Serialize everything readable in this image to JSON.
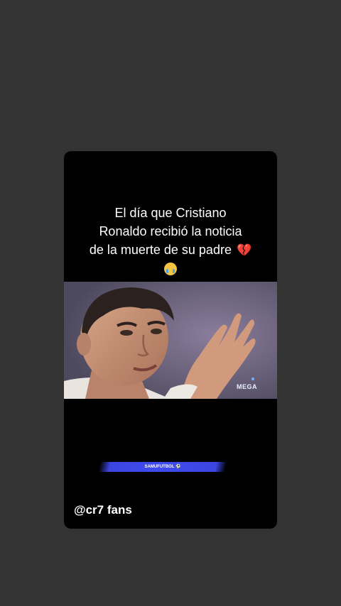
{
  "story": {
    "caption_lines": [
      "El día que Cristiano",
      "Ronaldo recibió la noticia",
      "de la muerte de su padre"
    ],
    "caption_emoji_heart": "💔",
    "handle": "@cr7 fans",
    "banner_text": "SAMUFUTBOL ⚽",
    "watermark": "MEGA"
  },
  "colors": {
    "background": "#333333",
    "card": "#000000",
    "banner": "#3f4bef",
    "heart": "#e0243a"
  },
  "icons": [
    "broken-heart-icon",
    "crying-face-icon",
    "soccer-ball-icon"
  ]
}
